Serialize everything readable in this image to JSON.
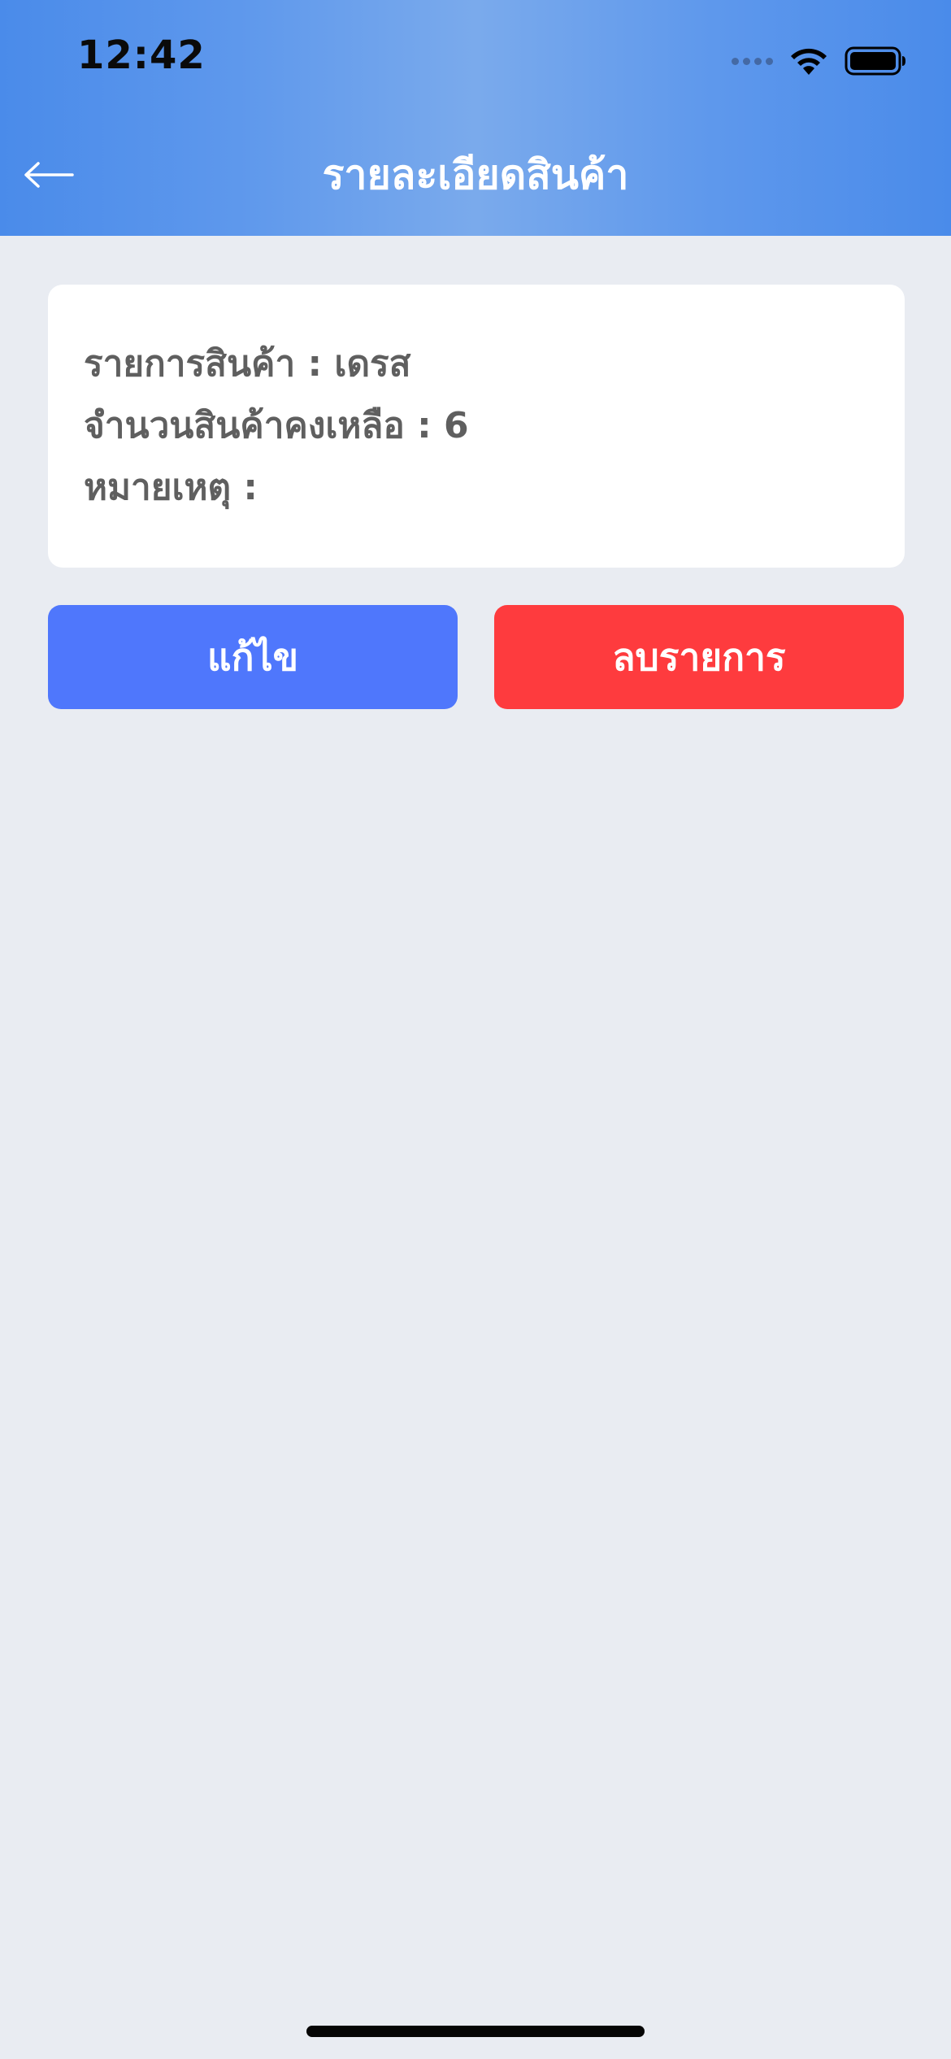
{
  "status_bar": {
    "time": "12:42",
    "icons": [
      "cellular-signal-icon",
      "wifi-icon",
      "battery-icon"
    ]
  },
  "header": {
    "title": "รายละเอียดสินค้า",
    "back_icon": "arrow-left-icon"
  },
  "details": {
    "item_label": "รายการสินค้า : เดรส",
    "stock_label": "จำนวนสินค้าคงเหลือ : 6",
    "note_label": "หมายเหตุ :"
  },
  "actions": {
    "edit_label": "แก้ไข",
    "delete_label": "ลบรายการ"
  },
  "colors": {
    "header_gradient": [
      "#4a8bea",
      "#7aaaec"
    ],
    "background": "#e9ecf2",
    "edit_button": "#4f77fc",
    "delete_button": "#fe3b3e"
  }
}
